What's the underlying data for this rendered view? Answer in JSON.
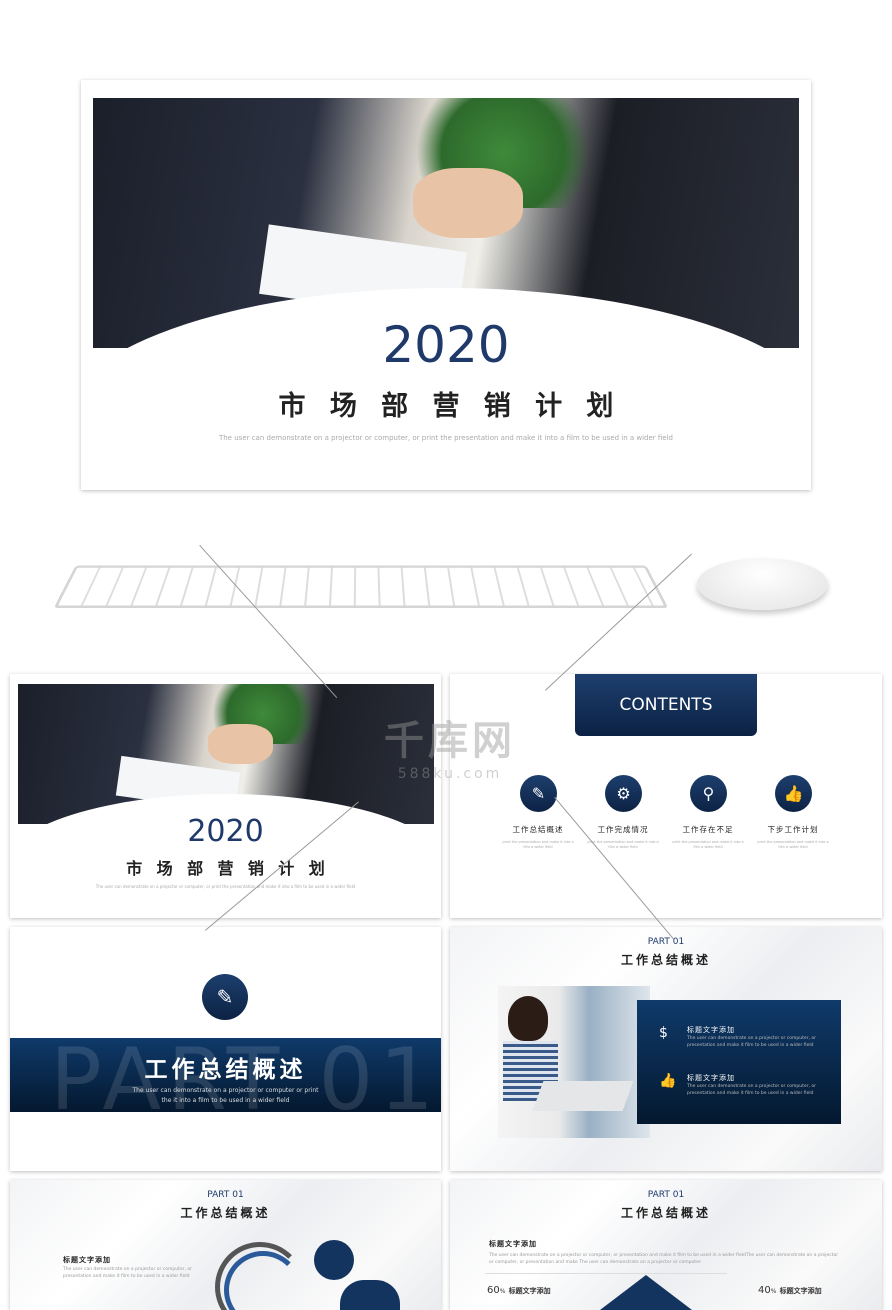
{
  "cover": {
    "year": "2020",
    "title_chars": [
      "市",
      "场",
      "部",
      "营",
      "销",
      "计",
      "划"
    ],
    "subtitle": "The user can demonstrate on a projector or computer, or print the presentation and make it into a film to be used in a wider field"
  },
  "thumb1": {
    "year": "2020",
    "title_chars": [
      "市",
      "场",
      "部",
      "营",
      "销",
      "计",
      "划"
    ],
    "subtitle": "The user can demonstrate on a projector or computer, or print the presentation and make it into a film to be used in a wider field"
  },
  "contents": {
    "header": "CONTENTS",
    "items": [
      {
        "icon": "document-check-icon",
        "label": "工作总结概述",
        "desc": "print the presentation and make it into a film a wider field"
      },
      {
        "icon": "gear-cycle-icon",
        "label": "工作完成情况",
        "desc": "print the presentation and make it into a film a wider field"
      },
      {
        "icon": "magnifier-icon",
        "label": "工作存在不足",
        "desc": "print the presentation and make it into a film a wider field"
      },
      {
        "icon": "thumbs-up-icon",
        "label": "下步工作计划",
        "desc": "print the presentation and make it into a film a wider field"
      }
    ]
  },
  "watermark": {
    "brand": "千库网",
    "url": "588ku.com"
  },
  "section": {
    "bg_text": "PART 01",
    "title": "工作总结概述",
    "desc": "The user can demonstrate on a projector or computer or print the it into a film to be used in a wider field"
  },
  "slide4": {
    "part": "PART 01",
    "title": "工作总结概述",
    "items": [
      {
        "icon": "clock-dollar-icon",
        "heading": "标题文字添加",
        "desc": "The user can demonstrate on a projector or computer, or presentation and make it film to be used in a wider field"
      },
      {
        "icon": "thumbs-up-icon",
        "heading": "标题文字添加",
        "desc": "The user can demonstrate on a projector or computer, or presentation and make it film to be used in a wider field"
      }
    ]
  },
  "slide5": {
    "part": "PART 01",
    "title": "工作总结概述",
    "heading": "标题文字添加",
    "desc": "The user can demonstrate on a projector or computer, or presentation and make it film to be used in a wider field"
  },
  "slide6": {
    "part": "PART 01",
    "title": "工作总结概述",
    "heading": "标题文字添加",
    "desc": "The user can demonstrate on a projector or computer, or presentation and make it film to be used in a wider fieldThe user can demonstrate on a projector or computer, or presentation and make The user can demonstrate on a projector or computer.",
    "left_pct": "60",
    "left_label": "标题文字添加",
    "right_pct": "40",
    "right_label": "标题文字添加",
    "pct_sign": "%"
  },
  "colors": {
    "navy": "#1f3a6a",
    "dark_navy": "#0c2244"
  }
}
